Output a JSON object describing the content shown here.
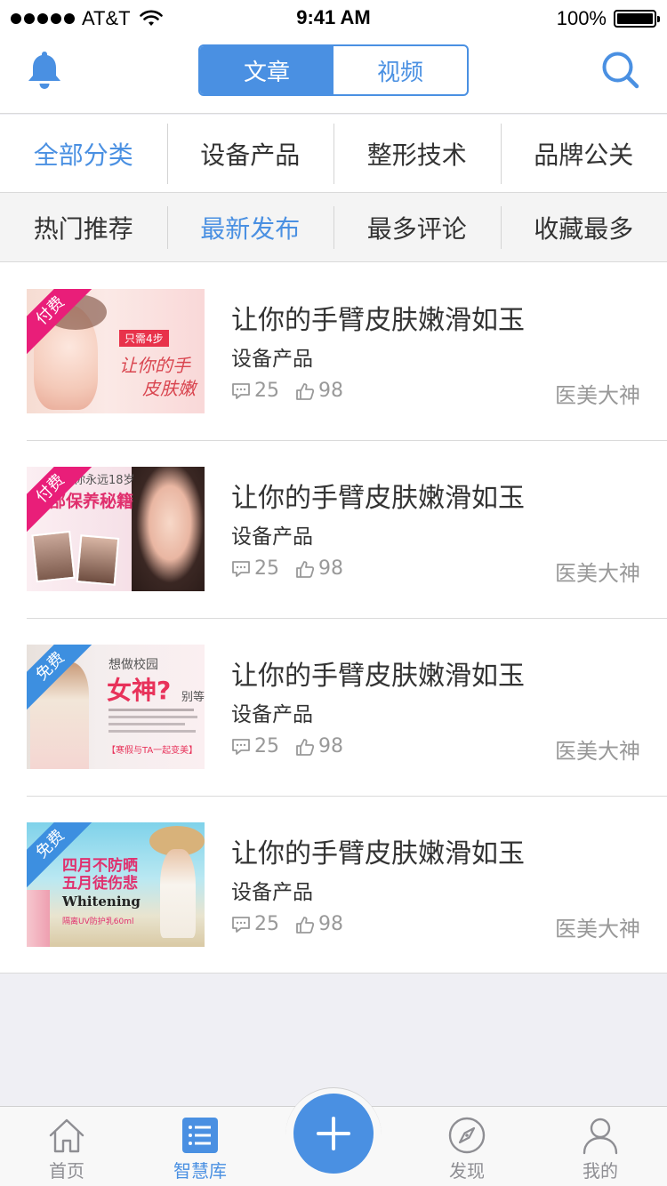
{
  "status_bar": {
    "carrier": "AT&T",
    "time": "9:41 AM",
    "battery": "100%"
  },
  "header": {
    "tabs": [
      {
        "label": "文章",
        "active": true
      },
      {
        "label": "视频",
        "active": false
      }
    ],
    "left_icon": "bell-icon",
    "right_icon": "search-icon"
  },
  "categories": [
    "全部分类",
    "设备产品",
    "整形技术",
    "品牌公关"
  ],
  "categories_selected": 0,
  "sorts": [
    "热门推荐",
    "最新发布",
    "最多评论",
    "收藏最多"
  ],
  "sorts_selected": 1,
  "articles": [
    {
      "badge": "付费",
      "badge_type": "paid",
      "thumb_lines": [
        "只需4步",
        "让你的手",
        "皮肤嫩"
      ],
      "title": "让你的手臂皮肤嫩滑如玉",
      "category": "设备产品",
      "comments": "25",
      "likes": "98",
      "author": "医美大神"
    },
    {
      "badge": "付费",
      "badge_type": "paid",
      "thumb_lines": [
        "让你永远18岁",
        "眼部保养秘籍"
      ],
      "title": "让你的手臂皮肤嫩滑如玉",
      "category": "设备产品",
      "comments": "25",
      "likes": "98",
      "author": "医美大神"
    },
    {
      "badge": "免费",
      "badge_type": "free",
      "thumb_lines": [
        "想做校园",
        "女神?",
        "别等",
        "【寒假与TA一起变美】"
      ],
      "title": "让你的手臂皮肤嫩滑如玉",
      "category": "设备产品",
      "comments": "25",
      "likes": "98",
      "author": "医美大神"
    },
    {
      "badge": "免费",
      "badge_type": "free",
      "thumb_lines": [
        "四月不防晒",
        "五月徒伤悲",
        "Whitening",
        "隔离UV防护乳60ml"
      ],
      "title": "让你的手臂皮肤嫩滑如玉",
      "category": "设备产品",
      "comments": "25",
      "likes": "98",
      "author": "医美大神"
    }
  ],
  "tabbar": {
    "items": [
      {
        "label": "首页",
        "icon": "home-icon",
        "active": false
      },
      {
        "label": "智慧库",
        "icon": "list-icon",
        "active": true
      },
      {
        "label": "发现",
        "icon": "compass-icon",
        "active": false
      },
      {
        "label": "我的",
        "icon": "profile-icon",
        "active": false
      }
    ],
    "fab_icon": "plus-icon"
  },
  "colors": {
    "accent": "#4a90e2",
    "paid_ribbon": "#e91e79",
    "free_ribbon": "#3d8fe0"
  }
}
